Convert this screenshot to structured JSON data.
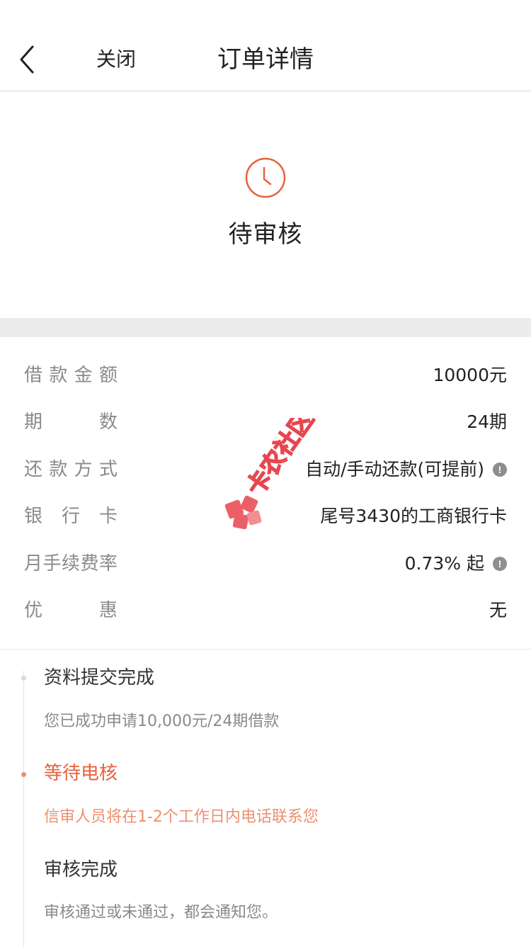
{
  "nav": {
    "close_label": "关闭",
    "title": "订单详情"
  },
  "status": {
    "icon": "clock-icon",
    "text": "待审核",
    "accent_color": "#e8613c"
  },
  "details": {
    "rows": [
      {
        "label": "借款金额",
        "value": "10000元",
        "info": false
      },
      {
        "label": "期数",
        "value": "24期",
        "info": false
      },
      {
        "label": "还款方式",
        "value": "自动/手动还款(可提前)",
        "info": true
      },
      {
        "label": "银行卡",
        "value": "尾号3430的工商银行卡",
        "info": false
      },
      {
        "label": "月手续费率",
        "value": "0.73% 起",
        "info": true
      },
      {
        "label": "优惠",
        "value": "无",
        "info": false
      }
    ],
    "info_icon": "!"
  },
  "watermark": {
    "text": "卡农社区"
  },
  "timeline": {
    "steps": [
      {
        "title": "资料提交完成",
        "desc": "您已成功申请10,000元/24期借款",
        "active": false
      },
      {
        "title": "等待电核",
        "desc": "信审人员将在1-2个工作日内电话联系您",
        "active": true
      },
      {
        "title": "审核完成",
        "desc": "审核通过或未通过，都会通知您。",
        "active": false
      }
    ]
  }
}
